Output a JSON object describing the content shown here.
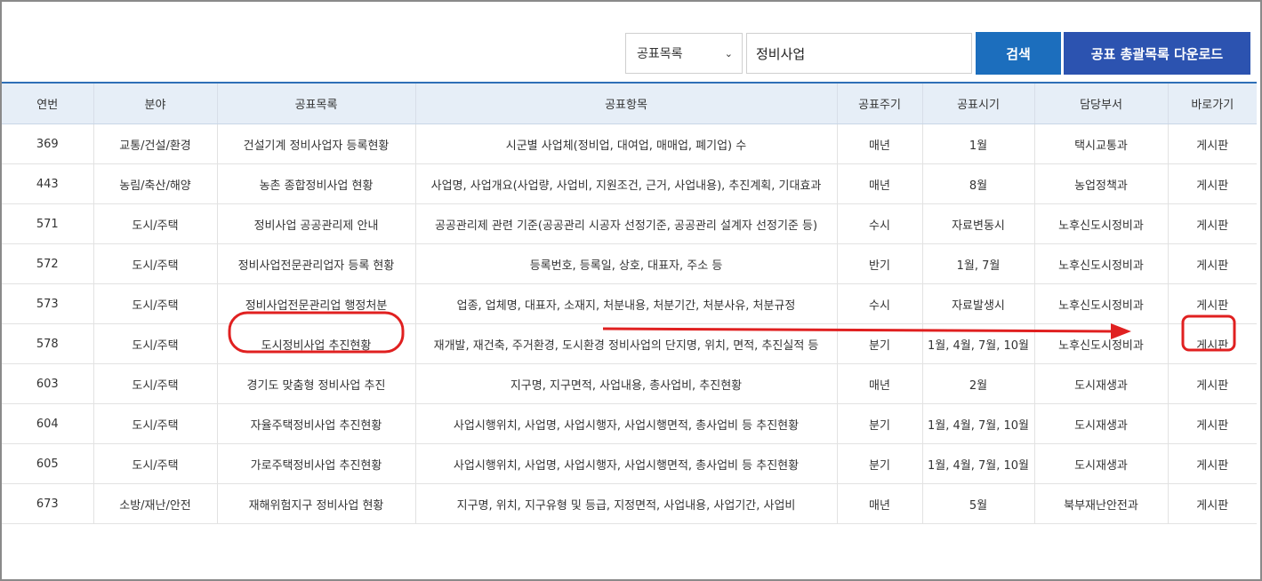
{
  "search": {
    "category_selected": "공표목록",
    "query": "정비사업",
    "search_label": "검색",
    "download_label": "공표 총괄목록 다운로드"
  },
  "table": {
    "headers": [
      "연번",
      "분야",
      "공표목록",
      "공표항목",
      "공표주기",
      "공표시기",
      "담당부서",
      "바로가기"
    ],
    "rows": [
      {
        "no": "369",
        "field": "교통/건설/환경",
        "list": "건설기계 정비사업자 등록현황",
        "items": "시군별 사업체(정비업, 대여업, 매매업, 폐기업) 수",
        "cycle": "매년",
        "timing": "1월",
        "dept": "택시교통과",
        "link": "게시판"
      },
      {
        "no": "443",
        "field": "농림/축산/해양",
        "list": "농촌 종합정비사업 현황",
        "items": "사업명, 사업개요(사업량, 사업비, 지원조건, 근거, 사업내용), 추진계획, 기대효과",
        "cycle": "매년",
        "timing": "8월",
        "dept": "농업정책과",
        "link": "게시판"
      },
      {
        "no": "571",
        "field": "도시/주택",
        "list": "정비사업 공공관리제 안내",
        "items": "공공관리제 관련 기준(공공관리 시공자 선정기준, 공공관리 설계자 선정기준 등)",
        "cycle": "수시",
        "timing": "자료변동시",
        "dept": "노후신도시정비과",
        "link": "게시판"
      },
      {
        "no": "572",
        "field": "도시/주택",
        "list": "정비사업전문관리업자 등록 현황",
        "items": "등록번호, 등록일, 상호, 대표자, 주소 등",
        "cycle": "반기",
        "timing": "1월, 7월",
        "dept": "노후신도시정비과",
        "link": "게시판"
      },
      {
        "no": "573",
        "field": "도시/주택",
        "list": "정비사업전문관리업 행정처분",
        "items": "업종, 업체명, 대표자, 소재지, 처분내용, 처분기간, 처분사유, 처분규정",
        "cycle": "수시",
        "timing": "자료발생시",
        "dept": "노후신도시정비과",
        "link": "게시판"
      },
      {
        "no": "578",
        "field": "도시/주택",
        "list": "도시정비사업 추진현황",
        "items": "재개발, 재건축, 주거환경, 도시환경 정비사업의 단지명, 위치, 면적, 추진실적 등",
        "cycle": "분기",
        "timing": "1월, 4월, 7월, 10월",
        "dept": "노후신도시정비과",
        "link": "게시판"
      },
      {
        "no": "603",
        "field": "도시/주택",
        "list": "경기도 맞춤형 정비사업 추진",
        "items": "지구명, 지구면적, 사업내용, 총사업비, 추진현황",
        "cycle": "매년",
        "timing": "2월",
        "dept": "도시재생과",
        "link": "게시판"
      },
      {
        "no": "604",
        "field": "도시/주택",
        "list": "자율주택정비사업 추진현황",
        "items": "사업시행위치, 사업명, 사업시행자, 사업시행면적, 총사업비 등 추진현황",
        "cycle": "분기",
        "timing": "1월, 4월, 7월, 10월",
        "dept": "도시재생과",
        "link": "게시판"
      },
      {
        "no": "605",
        "field": "도시/주택",
        "list": "가로주택정비사업 추진현황",
        "items": "사업시행위치, 사업명, 사업시행자, 사업시행면적, 총사업비 등 추진현황",
        "cycle": "분기",
        "timing": "1월, 4월, 7월, 10월",
        "dept": "도시재생과",
        "link": "게시판"
      },
      {
        "no": "673",
        "field": "소방/재난/안전",
        "list": "재해위험지구 정비사업 현황",
        "items": "지구명, 위치, 지구유형 및 등급, 지정면적, 사업내용, 사업기간, 사업비",
        "cycle": "매년",
        "timing": "5월",
        "dept": "북부재난안전과",
        "link": "게시판"
      }
    ]
  },
  "annotation_color": "#e02020"
}
